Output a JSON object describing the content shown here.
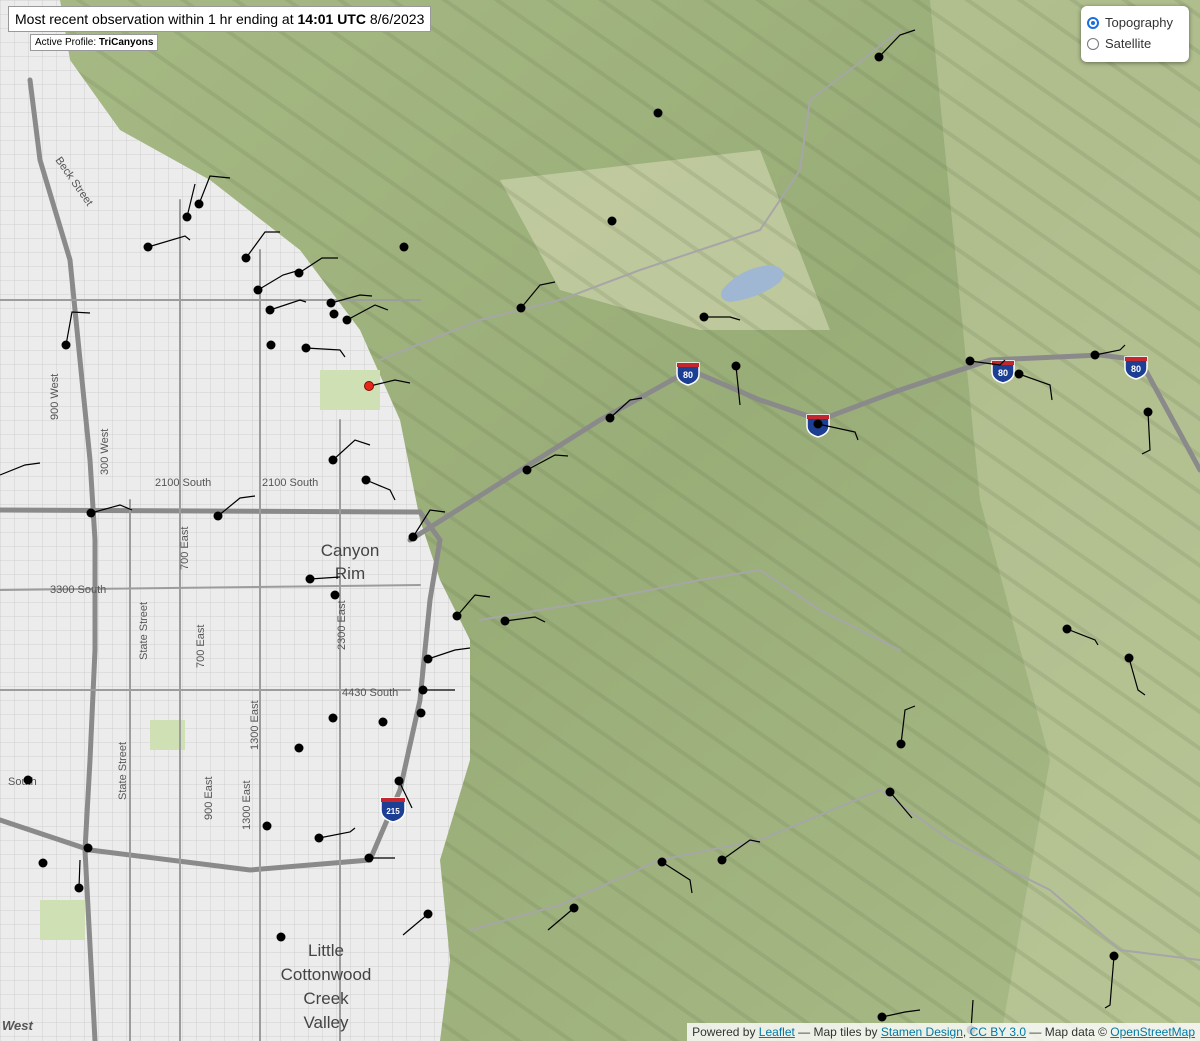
{
  "header": {
    "prefix": "Most recent observation within 1 hr ending at ",
    "time": "14:01 UTC",
    "date": " 8/6/2023"
  },
  "profile": {
    "label": "Active Profile: ",
    "value": "TriCanyons"
  },
  "layers": {
    "options": [
      {
        "label": "Topography",
        "selected": true
      },
      {
        "label": "Satellite",
        "selected": false
      }
    ]
  },
  "attribution": {
    "powered": "Powered by ",
    "leaflet": "Leaflet",
    "tiles": " — Map tiles by ",
    "stamen": "Stamen Design",
    "sep": ", ",
    "cc": "CC BY 3.0",
    "mapdata": " — Map data © ",
    "osm": "OpenStreetMap"
  },
  "map_labels": {
    "beck_street": "Beck Street",
    "w900": "900 West",
    "w300": "300 West",
    "s2100a": "2100 South",
    "s2100b": "2100 South",
    "s3300": "3300 South",
    "state_street1": "State Street",
    "state_street2": "State Street",
    "e700": "700 East",
    "e1300a": "1300 East",
    "e1300b": "1300 East",
    "e2300": "2300 East",
    "s4430": "4430 South",
    "e700b": "700 East",
    "e900": "900 East",
    "canyon_rim": [
      "Canyon",
      "Rim"
    ],
    "little_cottonwood": [
      "Little",
      "Cottonwood",
      "Creek",
      "Valley"
    ],
    "west_fragment": "West",
    "south_fragment": "South",
    "i80_1": "80",
    "i80_2": "80",
    "i80_3": "80",
    "i215": "215"
  },
  "colors": {
    "station": "#000000",
    "highlight_station": "#e8261a",
    "lake": "#9fb7d2",
    "interstate_shield": "#1c3f94"
  }
}
